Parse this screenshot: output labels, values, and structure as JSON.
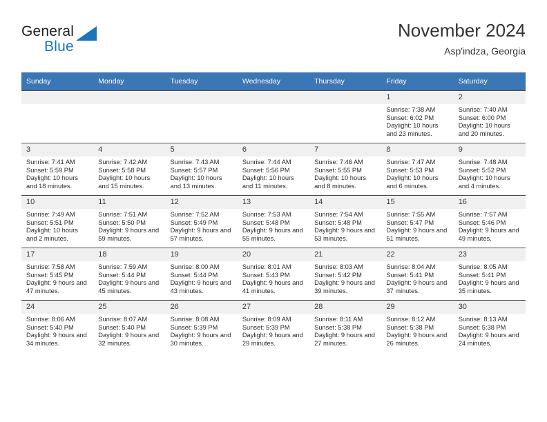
{
  "brand": {
    "word_one": "General",
    "word_two": "Blue",
    "triangle_icon": "triangle-icon"
  },
  "header": {
    "title": "November 2024",
    "subtitle": "Asp'indza, Georgia"
  },
  "colors": {
    "header_blue": "#3b76b5",
    "brand_blue": "#1b75bb",
    "daynum_band": "#f0f0f0",
    "row_border": "#4a4a4a"
  },
  "calendar": {
    "weekday_headers": [
      "Sunday",
      "Monday",
      "Tuesday",
      "Wednesday",
      "Thursday",
      "Friday",
      "Saturday"
    ],
    "labels": {
      "sunrise": "Sunrise:",
      "sunset": "Sunset:",
      "daylight": "Daylight:"
    },
    "weeks": [
      [
        {
          "day": "",
          "lines": []
        },
        {
          "day": "",
          "lines": []
        },
        {
          "day": "",
          "lines": []
        },
        {
          "day": "",
          "lines": []
        },
        {
          "day": "",
          "lines": []
        },
        {
          "day": "1",
          "lines": [
            "Sunrise: 7:38 AM",
            "Sunset: 6:02 PM",
            "Daylight: 10 hours and 23 minutes."
          ]
        },
        {
          "day": "2",
          "lines": [
            "Sunrise: 7:40 AM",
            "Sunset: 6:00 PM",
            "Daylight: 10 hours and 20 minutes."
          ]
        }
      ],
      [
        {
          "day": "3",
          "lines": [
            "Sunrise: 7:41 AM",
            "Sunset: 5:59 PM",
            "Daylight: 10 hours and 18 minutes."
          ]
        },
        {
          "day": "4",
          "lines": [
            "Sunrise: 7:42 AM",
            "Sunset: 5:58 PM",
            "Daylight: 10 hours and 15 minutes."
          ]
        },
        {
          "day": "5",
          "lines": [
            "Sunrise: 7:43 AM",
            "Sunset: 5:57 PM",
            "Daylight: 10 hours and 13 minutes."
          ]
        },
        {
          "day": "6",
          "lines": [
            "Sunrise: 7:44 AM",
            "Sunset: 5:56 PM",
            "Daylight: 10 hours and 11 minutes."
          ]
        },
        {
          "day": "7",
          "lines": [
            "Sunrise: 7:46 AM",
            "Sunset: 5:55 PM",
            "Daylight: 10 hours and 8 minutes."
          ]
        },
        {
          "day": "8",
          "lines": [
            "Sunrise: 7:47 AM",
            "Sunset: 5:53 PM",
            "Daylight: 10 hours and 6 minutes."
          ]
        },
        {
          "day": "9",
          "lines": [
            "Sunrise: 7:48 AM",
            "Sunset: 5:52 PM",
            "Daylight: 10 hours and 4 minutes."
          ]
        }
      ],
      [
        {
          "day": "10",
          "lines": [
            "Sunrise: 7:49 AM",
            "Sunset: 5:51 PM",
            "Daylight: 10 hours and 2 minutes."
          ]
        },
        {
          "day": "11",
          "lines": [
            "Sunrise: 7:51 AM",
            "Sunset: 5:50 PM",
            "Daylight: 9 hours and 59 minutes."
          ]
        },
        {
          "day": "12",
          "lines": [
            "Sunrise: 7:52 AM",
            "Sunset: 5:49 PM",
            "Daylight: 9 hours and 57 minutes."
          ]
        },
        {
          "day": "13",
          "lines": [
            "Sunrise: 7:53 AM",
            "Sunset: 5:48 PM",
            "Daylight: 9 hours and 55 minutes."
          ]
        },
        {
          "day": "14",
          "lines": [
            "Sunrise: 7:54 AM",
            "Sunset: 5:48 PM",
            "Daylight: 9 hours and 53 minutes."
          ]
        },
        {
          "day": "15",
          "lines": [
            "Sunrise: 7:55 AM",
            "Sunset: 5:47 PM",
            "Daylight: 9 hours and 51 minutes."
          ]
        },
        {
          "day": "16",
          "lines": [
            "Sunrise: 7:57 AM",
            "Sunset: 5:46 PM",
            "Daylight: 9 hours and 49 minutes."
          ]
        }
      ],
      [
        {
          "day": "17",
          "lines": [
            "Sunrise: 7:58 AM",
            "Sunset: 5:45 PM",
            "Daylight: 9 hours and 47 minutes."
          ]
        },
        {
          "day": "18",
          "lines": [
            "Sunrise: 7:59 AM",
            "Sunset: 5:44 PM",
            "Daylight: 9 hours and 45 minutes."
          ]
        },
        {
          "day": "19",
          "lines": [
            "Sunrise: 8:00 AM",
            "Sunset: 5:44 PM",
            "Daylight: 9 hours and 43 minutes."
          ]
        },
        {
          "day": "20",
          "lines": [
            "Sunrise: 8:01 AM",
            "Sunset: 5:43 PM",
            "Daylight: 9 hours and 41 minutes."
          ]
        },
        {
          "day": "21",
          "lines": [
            "Sunrise: 8:03 AM",
            "Sunset: 5:42 PM",
            "Daylight: 9 hours and 39 minutes."
          ]
        },
        {
          "day": "22",
          "lines": [
            "Sunrise: 8:04 AM",
            "Sunset: 5:41 PM",
            "Daylight: 9 hours and 37 minutes."
          ]
        },
        {
          "day": "23",
          "lines": [
            "Sunrise: 8:05 AM",
            "Sunset: 5:41 PM",
            "Daylight: 9 hours and 35 minutes."
          ]
        }
      ],
      [
        {
          "day": "24",
          "lines": [
            "Sunrise: 8:06 AM",
            "Sunset: 5:40 PM",
            "Daylight: 9 hours and 34 minutes."
          ]
        },
        {
          "day": "25",
          "lines": [
            "Sunrise: 8:07 AM",
            "Sunset: 5:40 PM",
            "Daylight: 9 hours and 32 minutes."
          ]
        },
        {
          "day": "26",
          "lines": [
            "Sunrise: 8:08 AM",
            "Sunset: 5:39 PM",
            "Daylight: 9 hours and 30 minutes."
          ]
        },
        {
          "day": "27",
          "lines": [
            "Sunrise: 8:09 AM",
            "Sunset: 5:39 PM",
            "Daylight: 9 hours and 29 minutes."
          ]
        },
        {
          "day": "28",
          "lines": [
            "Sunrise: 8:11 AM",
            "Sunset: 5:38 PM",
            "Daylight: 9 hours and 27 minutes."
          ]
        },
        {
          "day": "29",
          "lines": [
            "Sunrise: 8:12 AM",
            "Sunset: 5:38 PM",
            "Daylight: 9 hours and 26 minutes."
          ]
        },
        {
          "day": "30",
          "lines": [
            "Sunrise: 8:13 AM",
            "Sunset: 5:38 PM",
            "Daylight: 9 hours and 24 minutes."
          ]
        }
      ]
    ]
  }
}
